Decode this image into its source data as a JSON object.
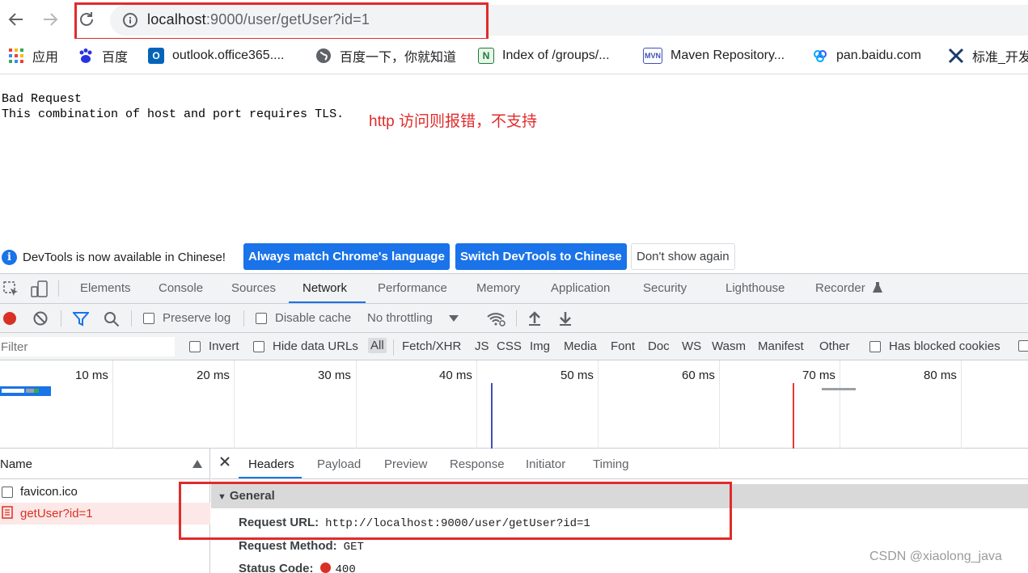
{
  "browser": {
    "url_host": "localhost",
    "url_path": ":9000/user/getUser?id=1"
  },
  "bookmarks": [
    {
      "label": "应用",
      "icon": "apps-grid-icon"
    },
    {
      "label": "百度",
      "icon": "baidu-icon"
    },
    {
      "label": "outlook.office365....",
      "icon": "outlook-icon"
    },
    {
      "label": "百度一下，你就知道",
      "icon": "globe-icon"
    },
    {
      "label": "Index of /groups/...",
      "icon": "nexus-icon"
    },
    {
      "label": "Maven Repository...",
      "icon": "mvn-icon"
    },
    {
      "label": "pan.baidu.com",
      "icon": "baidu-pan-icon"
    },
    {
      "label": "标准_开发",
      "icon": "tool-x-icon"
    }
  ],
  "page": {
    "line1": "Bad Request",
    "line2": "This combination of host and port requires TLS.",
    "annotation": "http 访问则报错，不支持"
  },
  "devtools": {
    "notice": {
      "text": "DevTools is now available in Chinese!",
      "btn_match": "Always match Chrome's language",
      "btn_switch": "Switch DevTools to Chinese",
      "btn_dismiss": "Don't show again"
    },
    "tabs": [
      "Elements",
      "Console",
      "Sources",
      "Network",
      "Performance",
      "Memory",
      "Application",
      "Security",
      "Lighthouse",
      "Recorder"
    ],
    "active_tab": "Network",
    "toolbar": {
      "preserve_log": "Preserve log",
      "disable_cache": "Disable cache",
      "throttling": "No throttling"
    },
    "filter": {
      "placeholder": "Filter",
      "invert": "Invert",
      "hide_data_urls": "Hide data URLs",
      "types": [
        "All",
        "Fetch/XHR",
        "JS",
        "CSS",
        "Img",
        "Media",
        "Font",
        "Doc",
        "WS",
        "Wasm",
        "Manifest",
        "Other"
      ],
      "has_blocked_cookies": "Has blocked cookies"
    },
    "timeline": {
      "ticks": [
        "10 ms",
        "20 ms",
        "30 ms",
        "40 ms",
        "50 ms",
        "60 ms",
        "70 ms",
        "80 ms"
      ]
    },
    "requests": {
      "header": "Name",
      "rows": [
        {
          "name": "favicon.ico",
          "error": false
        },
        {
          "name": "getUser?id=1",
          "error": true
        }
      ]
    },
    "detail": {
      "tabs": [
        "Headers",
        "Payload",
        "Preview",
        "Response",
        "Initiator",
        "Timing"
      ],
      "active_tab": "Headers",
      "general_label": "General",
      "request_url_key": "Request URL:",
      "request_url": "http://localhost:9000/user/getUser?id=1",
      "request_method_key": "Request Method:",
      "request_method": "GET",
      "status_code_key": "Status Code:",
      "status_code": "400"
    }
  },
  "watermark": "CSDN @xiaolong_java",
  "colors": {
    "annotation_red": "#e02b2b",
    "accent_blue": "#1a73e8",
    "error_row_bg": "#fce8e6",
    "error_text": "#d93025"
  }
}
